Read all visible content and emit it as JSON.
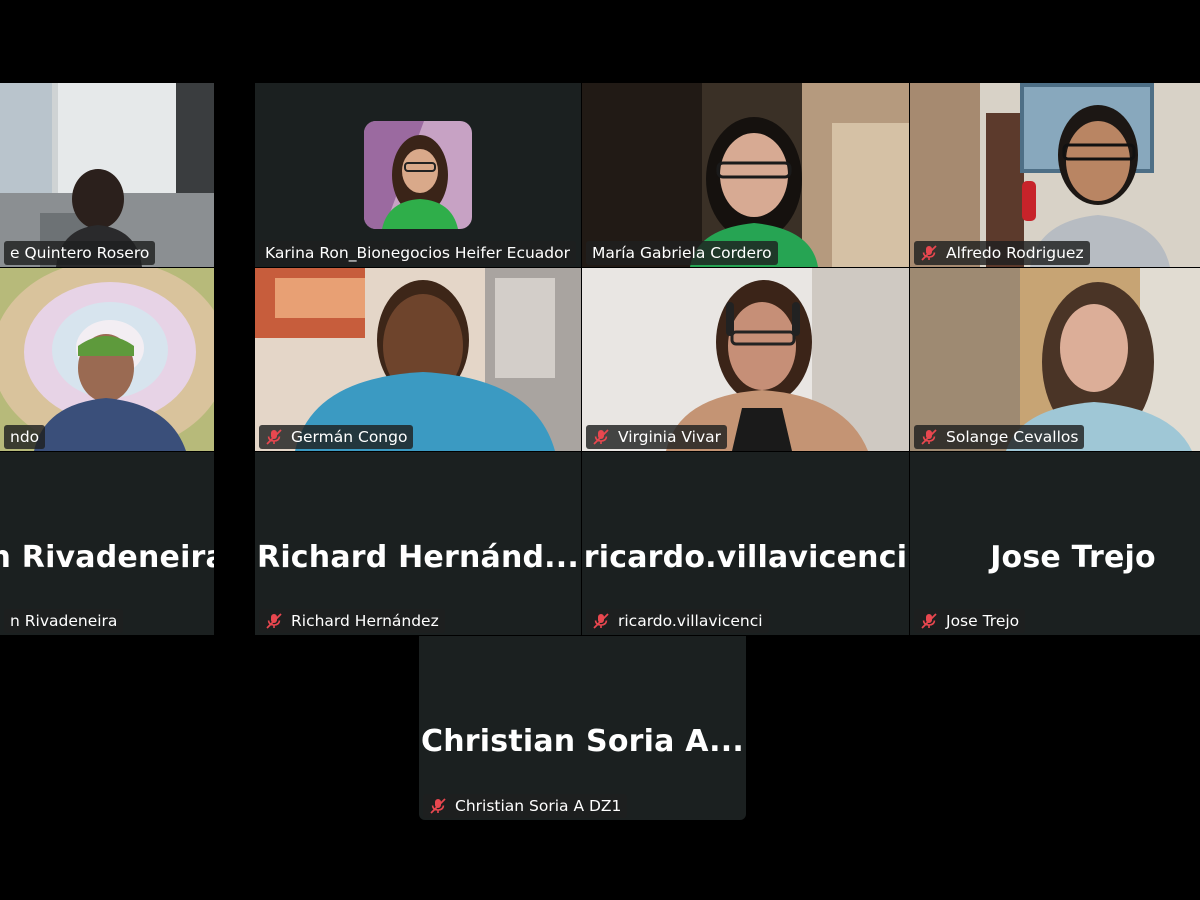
{
  "participants": [
    {
      "id": "p1",
      "name": "e Quintero Rosero",
      "muted": false
    },
    {
      "id": "p2",
      "name": "Karina Ron_Bionegocios Heifer Ecuador",
      "muted": false
    },
    {
      "id": "p3",
      "name": "María Gabriela Cordero",
      "muted": false,
      "speaking": true
    },
    {
      "id": "p4",
      "name": "Alfredo Rodriguez",
      "muted": true
    },
    {
      "id": "p5",
      "name": "ndo",
      "muted": false
    },
    {
      "id": "p6",
      "name": "Germán Congo",
      "muted": true
    },
    {
      "id": "p7",
      "name": "Virginia Vivar",
      "muted": true
    },
    {
      "id": "p8",
      "name": "Solange Cevallos",
      "muted": true
    },
    {
      "id": "p9",
      "name": "n Rivadeneira",
      "display": "len Rivadeneira",
      "muted": false
    },
    {
      "id": "p10",
      "name": "Richard Hernández",
      "display": "Richard  Hernánd...",
      "muted": true
    },
    {
      "id": "p11",
      "name": "ricardo.villavicenci",
      "display": "ricardo.villavicenci",
      "muted": true
    },
    {
      "id": "p12",
      "name": "Jose Trejo",
      "display": "Jose Trejo",
      "muted": true
    },
    {
      "id": "p13",
      "name": "Christian Soria A DZ1",
      "display": "Christian  Soria  A...",
      "muted": true
    }
  ],
  "colors": {
    "active_border": "#2ce07a",
    "muted_icon": "#e8474f",
    "tile_bg": "#1b2020"
  }
}
